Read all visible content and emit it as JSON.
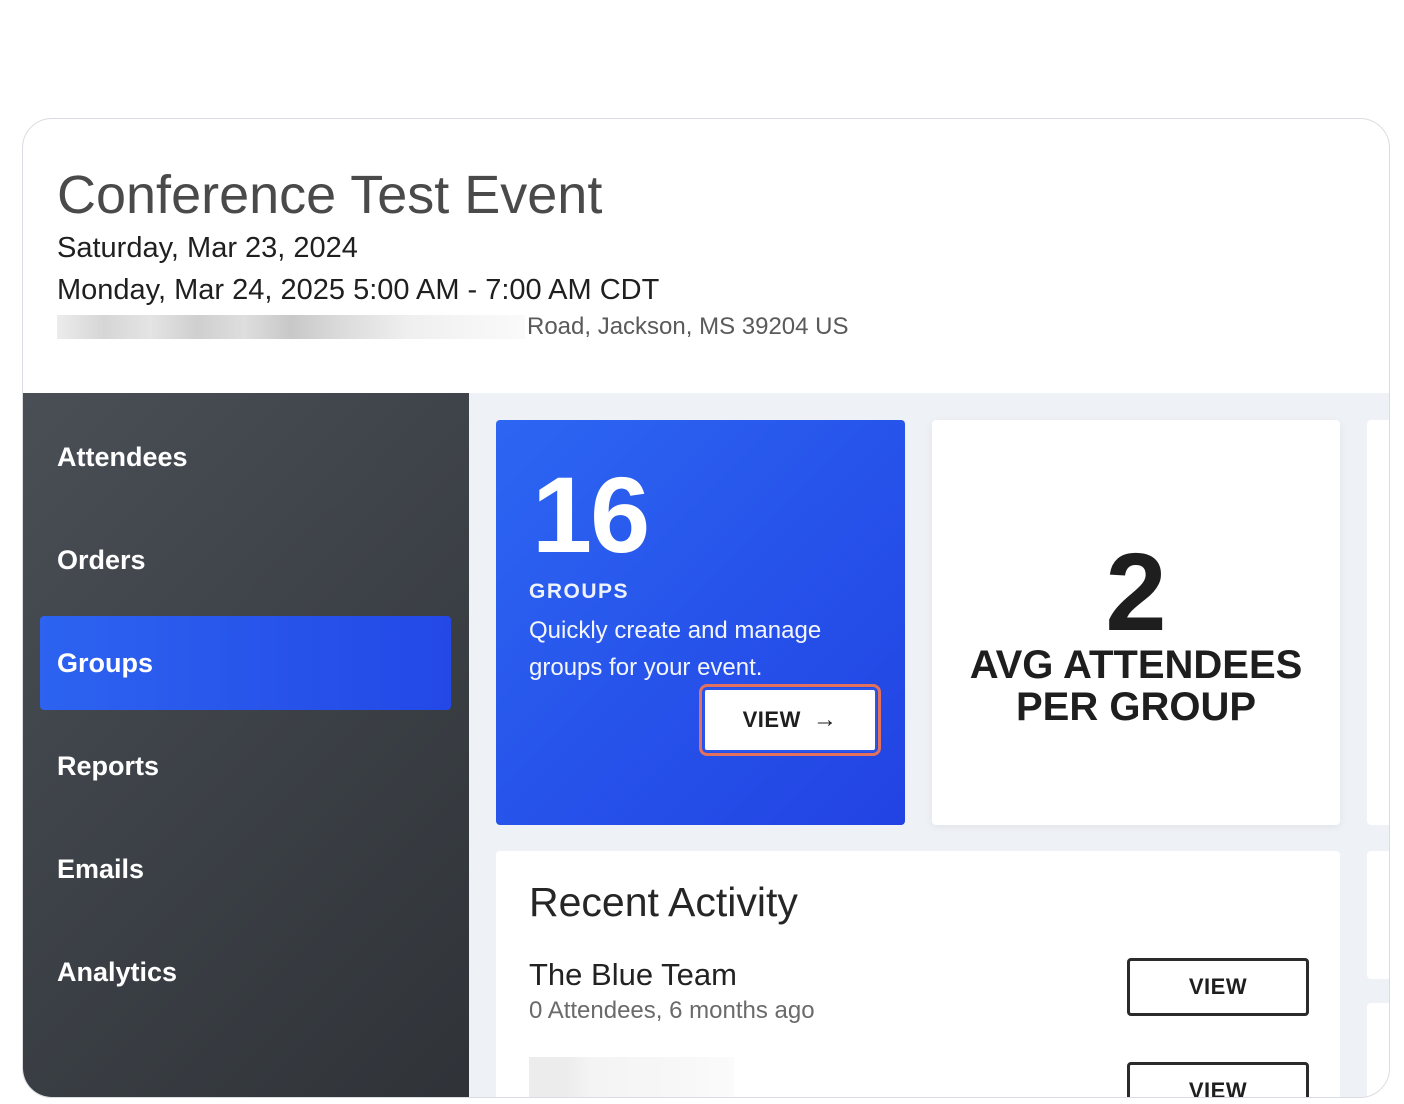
{
  "event": {
    "title": "Conference Test Event",
    "date_line_1": "Saturday, Mar 23, 2024",
    "date_line_2": "Monday, Mar 24, 2025 5:00 AM - 7:00 AM CDT",
    "address_visible": "Road, Jackson, MS 39204 US"
  },
  "sidebar": {
    "items": [
      {
        "label": "Attendees",
        "active": false
      },
      {
        "label": "Orders",
        "active": false
      },
      {
        "label": "Groups",
        "active": true
      },
      {
        "label": "Reports",
        "active": false
      },
      {
        "label": "Emails",
        "active": false
      },
      {
        "label": "Analytics",
        "active": false
      }
    ]
  },
  "groups_card": {
    "count": "16",
    "label": "GROUPS",
    "description": "Quickly create and manage groups for your event.",
    "button_label": "VIEW",
    "button_icon": "arrow-right-icon"
  },
  "avg_card": {
    "value": "2",
    "label": "AVG ATTENDEES PER GROUP"
  },
  "recent_activity": {
    "title": "Recent Activity",
    "items": [
      {
        "name": "The Blue Team",
        "meta": "0 Attendees, 6 months ago",
        "button_label": "VIEW"
      },
      {
        "button_label": "VIEW"
      }
    ]
  },
  "colors": {
    "accent": "#2652ea",
    "sidebar_bg": "#3d4248",
    "focus_ring": "#e2715e"
  }
}
